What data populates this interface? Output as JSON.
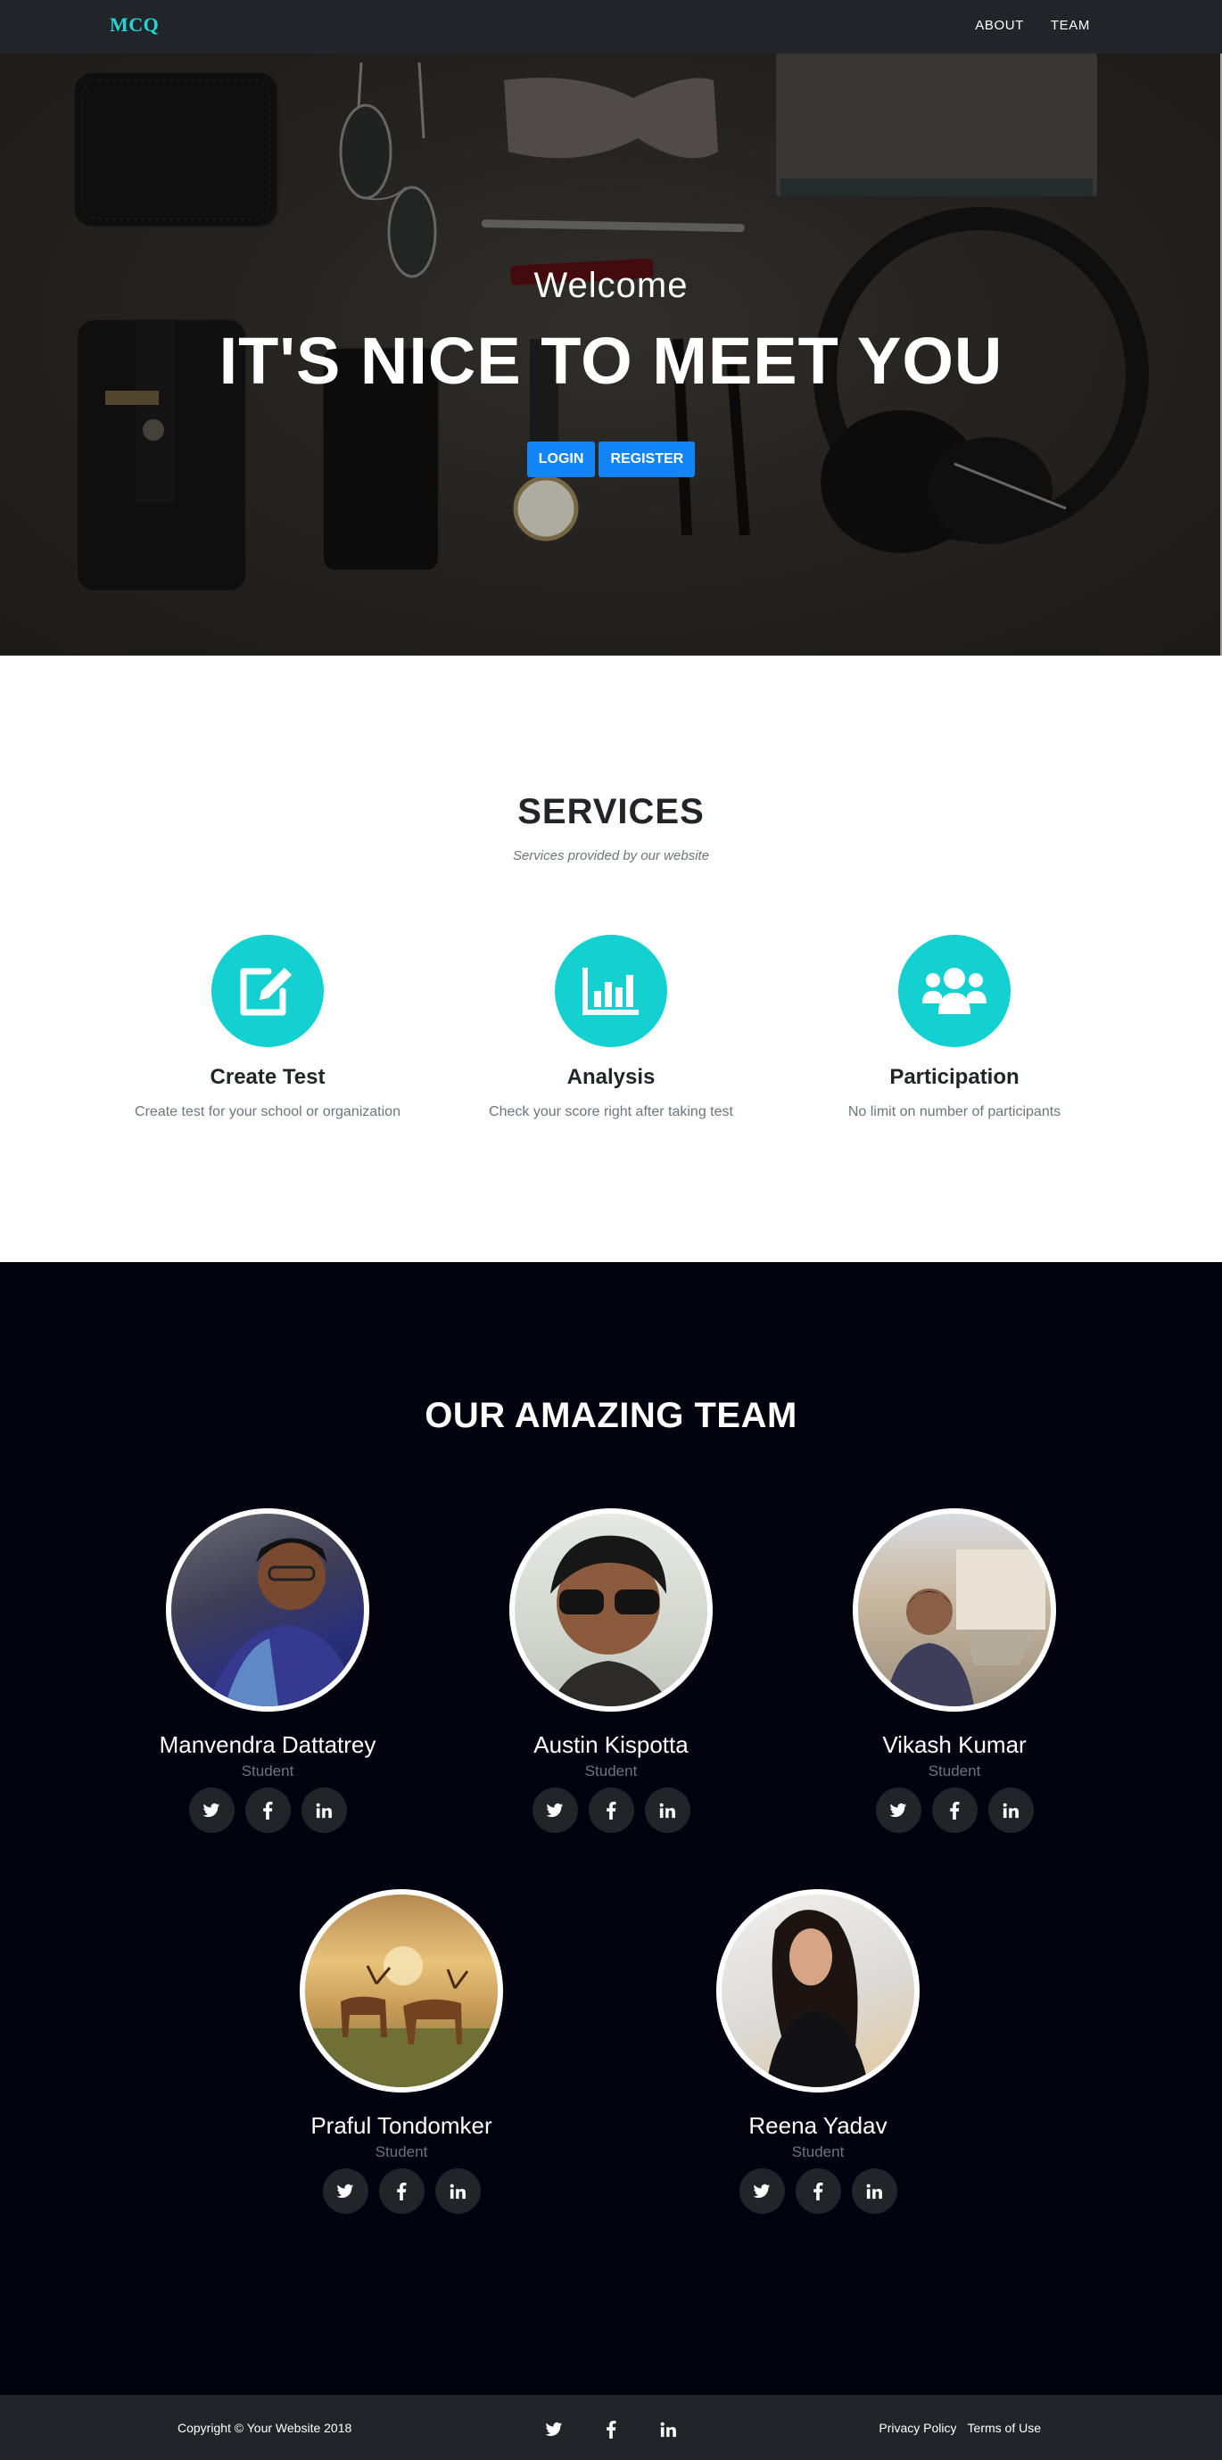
{
  "navbar": {
    "brand": "MCQ",
    "links": [
      "ABOUT",
      "TEAM"
    ]
  },
  "hero": {
    "welcome": "Welcome",
    "heading": "IT'S NICE TO MEET YOU",
    "buttons": [
      "LOGIN",
      "REGISTER"
    ]
  },
  "services": {
    "title": "SERVICES",
    "subtitle": "Services provided by our website",
    "items": [
      {
        "icon": "edit-icon",
        "title": "Create Test",
        "text": "Create test for your school or organization"
      },
      {
        "icon": "bar-chart-icon",
        "title": "Analysis",
        "text": "Check your score right after taking test"
      },
      {
        "icon": "users-icon",
        "title": "Participation",
        "text": "No limit on number of participants"
      }
    ]
  },
  "team": {
    "title": "OUR AMAZING TEAM",
    "members": [
      {
        "name": "Manvendra Dattatrey",
        "role": "Student"
      },
      {
        "name": "Austin Kispotta",
        "role": "Student"
      },
      {
        "name": "Vikash Kumar",
        "role": "Student"
      },
      {
        "name": "Praful Tondomker",
        "role": "Student"
      },
      {
        "name": "Reena Yadav",
        "role": "Student"
      }
    ],
    "social_icons": [
      "twitter-icon",
      "facebook-icon",
      "linkedin-icon"
    ]
  },
  "footer": {
    "copyright": "Copyright © Your Website 2018",
    "links": [
      "Privacy Policy",
      "Terms of Use"
    ]
  },
  "colors": {
    "accent": "#13d1d1",
    "brand": "#23d5d5",
    "primary_button": "#1285f8",
    "navbar": "#212529",
    "team_background": "#03020f"
  }
}
